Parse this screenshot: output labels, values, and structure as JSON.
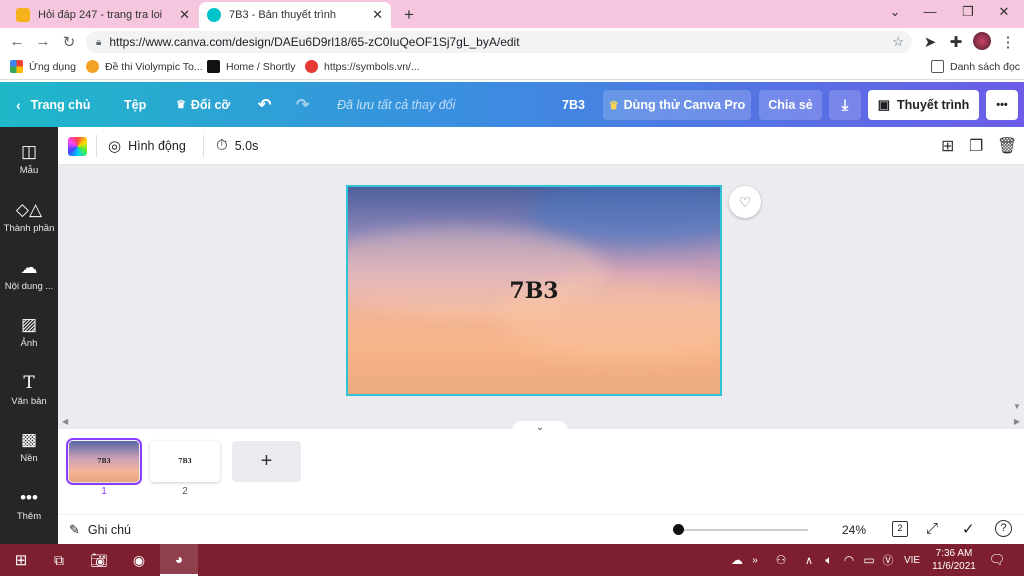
{
  "browser": {
    "tabs": [
      {
        "title": "Hỏi đáp 247 - trang tra loi",
        "active": false
      },
      {
        "title": "7B3 - Bản thuyết trình",
        "active": true
      }
    ],
    "new_tab": "+",
    "url": "https://www.canva.com/design/DAEu6D9rl18/65-zC0IuQeOF1Sj7gL_byA/edit",
    "bookmarks": [
      {
        "label": "Ứng dụng"
      },
      {
        "label": "Đề thi Violympic To..."
      },
      {
        "label": "Home / Shortly"
      },
      {
        "label": "https://symbols.vn/..."
      }
    ],
    "reading_list": "Danh sách đọc"
  },
  "header": {
    "home": "Trang chủ",
    "file": "Tệp",
    "resize": "Đổi cỡ",
    "saved_status": "Đã lưu tất cả thay đổi",
    "doc_title": "7B3",
    "try_pro": "Dùng thử Canva Pro",
    "share": "Chia sẻ",
    "present": "Thuyết trình",
    "more": "•••"
  },
  "sidebar": {
    "items": [
      {
        "label": "Mẫu",
        "icon": "template-icon"
      },
      {
        "label": "Thành phần",
        "icon": "elements-icon"
      },
      {
        "label": "Nội dung ...",
        "icon": "upload-icon"
      },
      {
        "label": "Ảnh",
        "icon": "photo-icon"
      },
      {
        "label": "Văn bản",
        "icon": "text-icon"
      },
      {
        "label": "Nền",
        "icon": "background-icon"
      },
      {
        "label": "Thêm",
        "icon": "more-icon"
      }
    ]
  },
  "toolbar": {
    "animation": "Hình động",
    "duration": "5.0s"
  },
  "canvas": {
    "slide_title": "7B3"
  },
  "pages": [
    {
      "number": "1",
      "label": "7B3"
    },
    {
      "number": "2",
      "label": "7B3"
    }
  ],
  "add_page": "+",
  "footer": {
    "notes": "Ghi chú",
    "zoom": "24%",
    "page_count": "2",
    "zoom_level": 0.0
  },
  "taskbar": {
    "language": "VIE",
    "time": "7:36 AM",
    "date": "11/6/2021"
  },
  "colors": {
    "tab_strip": "#f5c6dd",
    "header_gradient_start": "#1fb8c9",
    "header_gradient_end": "#6c5ce7",
    "sidebar": "#252627",
    "taskbar": "#7d1f2e",
    "selection": "#2ec4d6",
    "page_active_border": "#8b3dff"
  }
}
